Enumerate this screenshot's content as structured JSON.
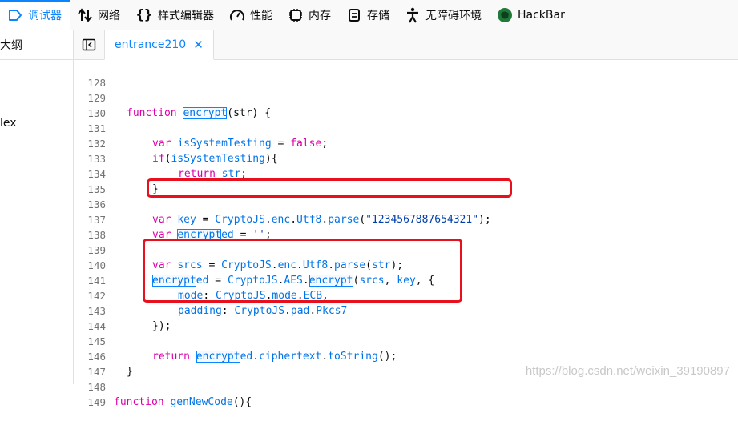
{
  "toolbar": {
    "tabs": [
      {
        "label": "调试器",
        "icon": "debugger-icon",
        "active": true
      },
      {
        "label": "网络",
        "icon": "network-arrows-icon"
      },
      {
        "label": "样式编辑器",
        "icon": "braces-icon"
      },
      {
        "label": "性能",
        "icon": "gauge-icon"
      },
      {
        "label": "内存",
        "icon": "memory-chip-icon"
      },
      {
        "label": "存储",
        "icon": "storage-icon"
      },
      {
        "label": "无障碍环境",
        "icon": "accessibility-icon"
      },
      {
        "label": "HackBar",
        "icon": "hackbar-logo-icon"
      }
    ]
  },
  "left_panel": {
    "header": "大纲",
    "item": "lex"
  },
  "editor_tab": {
    "filename": "entrance210",
    "close_glyph": "✕"
  },
  "code": {
    "lines": [
      {
        "n": "128",
        "text": ""
      },
      {
        "n": "129",
        "text": "function encrypt(str) {"
      },
      {
        "n": "130",
        "text": ""
      },
      {
        "n": "131",
        "text": "var isSystemTesting = false;"
      },
      {
        "n": "132",
        "text": "if(isSystemTesting){"
      },
      {
        "n": "133",
        "text": "return str;"
      },
      {
        "n": "134",
        "text": "}"
      },
      {
        "n": "135",
        "text": ""
      },
      {
        "n": "136",
        "text": "var key = CryptoJS.enc.Utf8.parse(\"1234567887654321\");"
      },
      {
        "n": "137",
        "text": "var encrypted = '';"
      },
      {
        "n": "138",
        "text": ""
      },
      {
        "n": "139",
        "text": "var srcs = CryptoJS.enc.Utf8.parse(str);"
      },
      {
        "n": "140",
        "text": "encrypted = CryptoJS.AES.encrypt(srcs, key, {"
      },
      {
        "n": "141",
        "text": "mode: CryptoJS.mode.ECB,"
      },
      {
        "n": "142",
        "text": "padding: CryptoJS.pad.Pkcs7"
      },
      {
        "n": "143",
        "text": "});"
      },
      {
        "n": "144",
        "text": ""
      },
      {
        "n": "145",
        "text": "return encrypted.ciphertext.toString();"
      },
      {
        "n": "146",
        "text": "}"
      },
      {
        "n": "147",
        "text": ""
      },
      {
        "n": "148",
        "text": "function genNewCode(){"
      },
      {
        "n": "149",
        "text": ""
      }
    ]
  },
  "watermark": "https://blog.csdn.net/weixin_39190897",
  "colors": {
    "accent": "#0a84ff",
    "keyword": "#dd00a9",
    "identifier": "#0074e8",
    "string": "#003eaa",
    "annotation_box": "#e8101c"
  }
}
